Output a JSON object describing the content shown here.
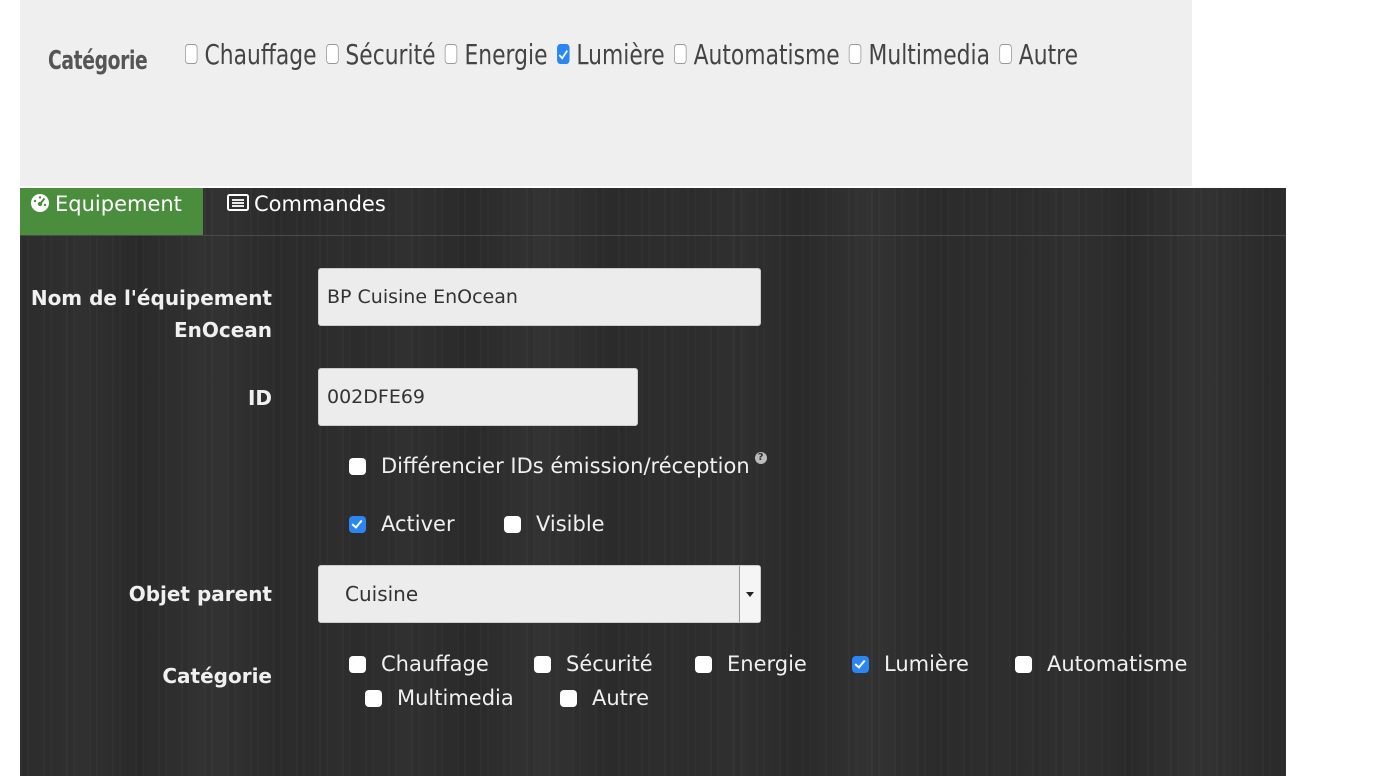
{
  "top_section": {
    "label": "Catégorie",
    "options": [
      {
        "label": "Chauffage",
        "checked": false
      },
      {
        "label": "Sécurité",
        "checked": false
      },
      {
        "label": "Energie",
        "checked": false
      },
      {
        "label": "Lumière",
        "checked": true
      },
      {
        "label": "Automatisme",
        "checked": false
      },
      {
        "label": "Multimedia",
        "checked": false
      },
      {
        "label": "Autre",
        "checked": false
      }
    ]
  },
  "tabs": [
    {
      "label": "Equipement",
      "icon": "dashboard-icon",
      "active": true
    },
    {
      "label": "Commandes",
      "icon": "list-icon",
      "active": false
    }
  ],
  "form": {
    "name_label_line1": "Nom de l'équipement",
    "name_label_line2": "EnOcean",
    "name_value": "BP Cuisine EnOcean",
    "id_label": "ID",
    "id_value": "002DFE69",
    "diff_ids_label": "Différencier IDs émission/réception",
    "diff_ids_checked": false,
    "activer_label": "Activer",
    "activer_checked": true,
    "visible_label": "Visible",
    "visible_checked": false,
    "parent_label": "Objet parent",
    "parent_value": "Cuisine",
    "category_label": "Catégorie",
    "categories": [
      {
        "label": "Chauffage",
        "checked": false
      },
      {
        "label": "Sécurité",
        "checked": false
      },
      {
        "label": "Energie",
        "checked": false
      },
      {
        "label": "Lumière",
        "checked": true
      },
      {
        "label": "Automatisme",
        "checked": false
      },
      {
        "label": "Multimedia",
        "checked": false
      },
      {
        "label": "Autre",
        "checked": false
      }
    ]
  },
  "colors": {
    "active_tab": "#4a8d3c",
    "checkbox_checked": "#2a86f3",
    "top_panel_bg": "#efefef"
  }
}
